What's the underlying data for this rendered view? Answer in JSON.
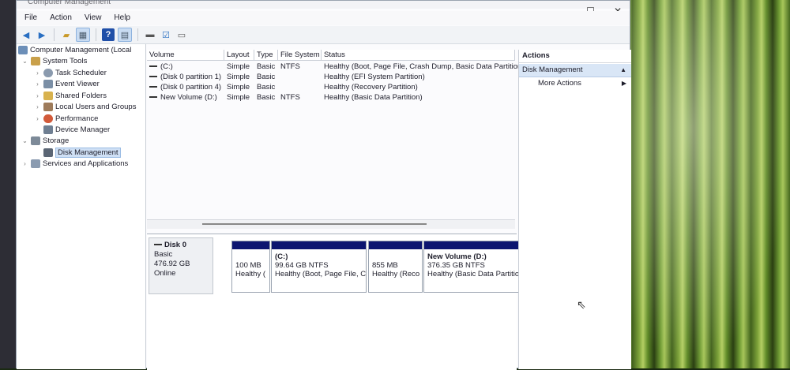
{
  "window": {
    "title": "Computer Management",
    "controls": [
      "—",
      "☐",
      "✕"
    ]
  },
  "menu": [
    "File",
    "Action",
    "View",
    "Help"
  ],
  "toolbar_icons": [
    "back-icon",
    "forward-icon",
    "up-folder-icon",
    "show-hide-tree-icon",
    "help-icon",
    "properties-icon",
    "disk-icon",
    "check-icon",
    "layout-icon"
  ],
  "tree": {
    "root": "Computer Management (Local",
    "system_tools": "System Tools",
    "task_scheduler": "Task Scheduler",
    "event_viewer": "Event Viewer",
    "shared_folders": "Shared Folders",
    "local_users": "Local Users and Groups",
    "performance": "Performance",
    "device_manager": "Device Manager",
    "storage": "Storage",
    "disk_management": "Disk Management",
    "services": "Services and Applications"
  },
  "volumes": {
    "headers": [
      "Volume",
      "Layout",
      "Type",
      "File System",
      "Status"
    ],
    "rows": [
      [
        "(C:)",
        "Simple",
        "Basic",
        "NTFS",
        "Healthy (Boot, Page File, Crash Dump, Basic Data Partition)"
      ],
      [
        "(Disk 0 partition 1)",
        "Simple",
        "Basic",
        "",
        "Healthy (EFI System Partition)"
      ],
      [
        "(Disk 0 partition 4)",
        "Simple",
        "Basic",
        "",
        "Healthy (Recovery Partition)"
      ],
      [
        "New Volume (D:)",
        "Simple",
        "Basic",
        "NTFS",
        "Healthy (Basic Data Partition)"
      ]
    ]
  },
  "disk": {
    "name": "Disk 0",
    "type": "Basic",
    "size": "476.92 GB",
    "state": "Online",
    "partitions": [
      {
        "name": "",
        "size": "100 MB",
        "status": "Healthy ("
      },
      {
        "name": "(C:)",
        "size": "99.64 GB NTFS",
        "status": "Healthy (Boot, Page File, C"
      },
      {
        "name": "",
        "size": "855 MB",
        "status": "Healthy (Reco"
      },
      {
        "name": "New Volume  (D:)",
        "size": "376.35 GB NTFS",
        "status": "Healthy (Basic Data Partition)"
      }
    ]
  },
  "actions": {
    "header": "Actions",
    "section": "Disk Management",
    "more": "More Actions"
  },
  "colors": {
    "partition_stripe": "#0c1570",
    "selection": "#cfe0f5"
  }
}
